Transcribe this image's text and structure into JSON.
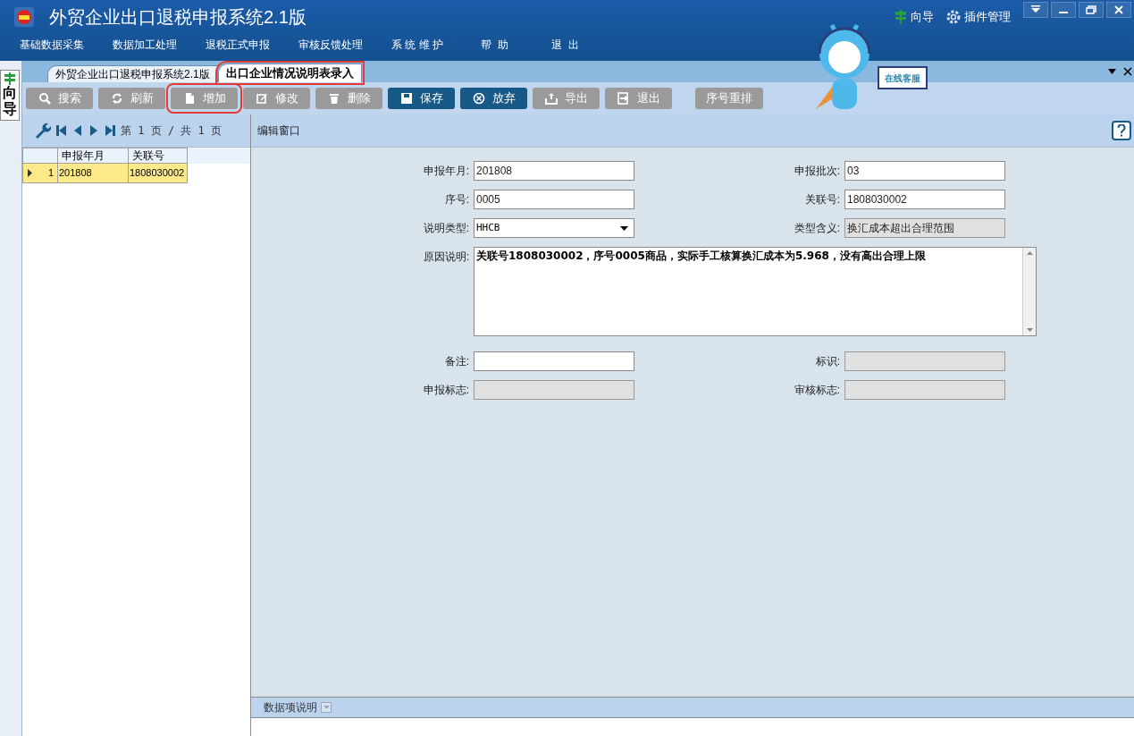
{
  "window": {
    "title": "外贸企业出口退税申报系统2.1版",
    "top_links": [
      {
        "label": "向导",
        "kind": "guide"
      },
      {
        "label": "插件管理",
        "kind": "gear"
      }
    ]
  },
  "menu": [
    "基础数据采集",
    "数据加工处理",
    "退税正式申报",
    "审核反馈处理",
    "系 统 维 护",
    "帮  助",
    "退  出"
  ],
  "assistant": {
    "label": "在线客服"
  },
  "side_tab": {
    "label": "向导"
  },
  "tabs": [
    {
      "label": "外贸企业出口退税申报系统2.1版",
      "selected": false,
      "highlighted": false
    },
    {
      "label": "出口企业情况说明表录入",
      "selected": true,
      "highlighted": true
    }
  ],
  "toolbar": [
    {
      "label": "搜索",
      "dark": false,
      "highlighted": false
    },
    {
      "label": "刷新",
      "dark": false,
      "highlighted": false
    },
    {
      "label": "增加",
      "dark": false,
      "highlighted": true
    },
    {
      "label": "修改",
      "dark": false,
      "highlighted": false
    },
    {
      "label": "删除",
      "dark": false,
      "highlighted": false
    },
    {
      "label": "保存",
      "dark": true,
      "highlighted": false
    },
    {
      "label": "放弃",
      "dark": true,
      "highlighted": false
    },
    {
      "label": "导出",
      "dark": false,
      "highlighted": false
    },
    {
      "label": "退出",
      "dark": false,
      "highlighted": false
    },
    {
      "label": "序号重排",
      "dark": false,
      "highlighted": false
    }
  ],
  "pager": {
    "text": "第 1 页 / 共 1 页"
  },
  "table": {
    "columns": [
      "申报年月",
      "关联号"
    ],
    "rows": [
      {
        "index": "1",
        "selected": true,
        "cells": [
          "201808",
          "1808030002"
        ]
      }
    ]
  },
  "editor": {
    "title": "编辑窗口",
    "rows": [
      [
        {
          "label": "申报年月:",
          "value": "201808",
          "kind": "input",
          "disabled": false
        },
        {
          "label": "申报批次:",
          "value": "03",
          "kind": "input",
          "disabled": false
        }
      ],
      [
        {
          "label": "序号:",
          "value": "0005",
          "kind": "input",
          "disabled": false
        },
        {
          "label": "关联号:",
          "value": "1808030002",
          "kind": "input",
          "disabled": false
        }
      ],
      [
        {
          "label": "说明类型:",
          "value": "HHCB",
          "kind": "select",
          "disabled": false
        },
        {
          "label": "类型含义:",
          "value": "换汇成本超出合理范围",
          "kind": "input",
          "disabled": true
        }
      ],
      [
        {
          "label": "原因说明:",
          "value": "关联号1808030002，序号0005商品，实际手工核算换汇成本为5.968，没有高出合理上限",
          "kind": "textarea",
          "disabled": false
        }
      ],
      [
        {
          "label": "备注:",
          "kind": "input",
          "disabled": false
        },
        {
          "label": "标识:",
          "kind": "input",
          "disabled": true
        }
      ],
      [
        {
          "label": "申报标志:",
          "kind": "input",
          "disabled": true
        },
        {
          "label": "审核标志:",
          "kind": "input",
          "disabled": true
        }
      ]
    ]
  },
  "footer": {
    "title": "数据项说明"
  }
}
